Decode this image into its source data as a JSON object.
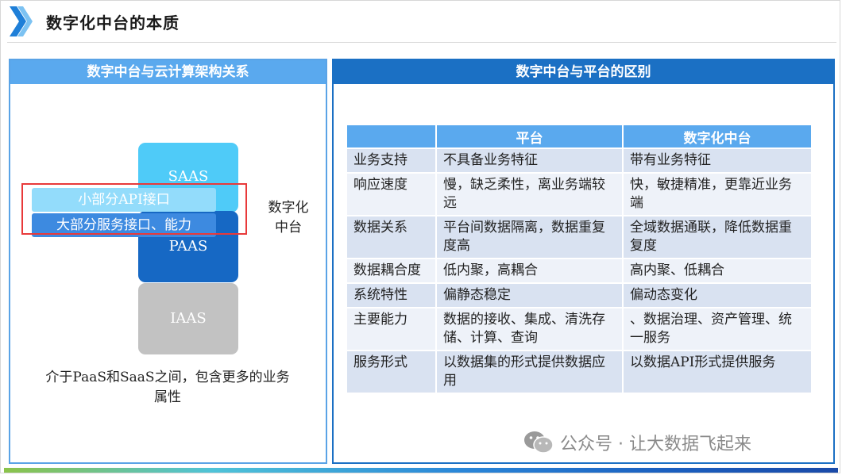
{
  "header": {
    "title": "数字化中台的本质"
  },
  "left_panel": {
    "title": "数字中台与云计算架构关系",
    "layers": {
      "saas": "SAAS",
      "paas": "PAAS",
      "iaas": "IAAS"
    },
    "bands": {
      "api": "小部分API接口",
      "services": "大部分服务接口、能力"
    },
    "side_label": "数字化中台",
    "note": "介于PaaS和SaaS之间，包含更多的业务属性"
  },
  "right_panel": {
    "title": "数字中台与平台的区别",
    "table": {
      "columns": [
        "",
        "平台",
        "数字化中台"
      ],
      "rows": [
        {
          "label": "业务支持",
          "platform": "不具备业务特征",
          "middle": "带有业务特征"
        },
        {
          "label": "响应速度",
          "platform": "慢，缺乏柔性，离业务端较远",
          "middle": "快，敏捷精准，更靠近业务端"
        },
        {
          "label": "数据关系",
          "platform": "平台间数据隔离，数据重复度高",
          "middle": "全域数据通联，降低数据重复度"
        },
        {
          "label": "数据耦合度",
          "platform": "低内聚，高耦合",
          "middle": "高内聚、低耦合"
        },
        {
          "label": "系统特性",
          "platform": "偏静态稳定",
          "middle": "偏动态变化"
        },
        {
          "label": "主要能力",
          "platform": "数据的接收、集成、清洗存储、计算、查询",
          "middle": "、数据治理、资产管理、统 一服务"
        },
        {
          "label": "服务形式",
          "platform": "以数据集的形式提供数据应用",
          "middle": "以数据API形式提供服务"
        }
      ]
    }
  },
  "watermark": {
    "text": "公众号 · 让大数据飞起来"
  },
  "colors": {
    "panel_head_left": "#5aa9ee",
    "panel_head_right": "#1b70c4",
    "saas": "#4fcbf8",
    "paas": "#1668c4",
    "iaas": "#c2c2c2",
    "highlight_box": "#e8393a"
  }
}
